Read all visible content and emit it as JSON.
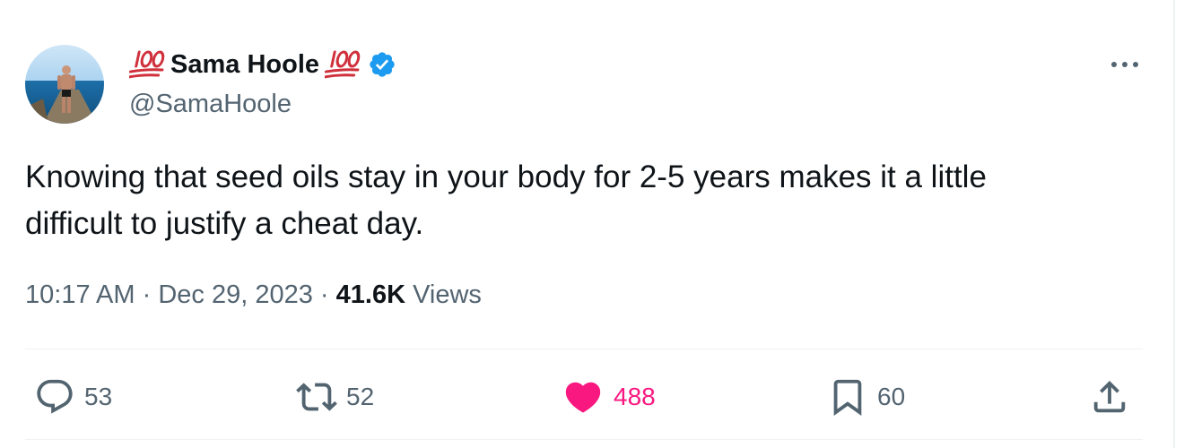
{
  "tweet": {
    "author": {
      "name_prefix_emoji": "💯",
      "display_name": "Sama Hoole",
      "name_suffix_emoji": "💯",
      "handle": "@SamaHoole",
      "verified": true
    },
    "text_line1": "Knowing that seed oils stay in your body for 2-5 years makes it a little",
    "text_line2": "difficult to justify a cheat day.",
    "time": "10:17 AM",
    "separator": "·",
    "date": "Dec 29, 2023",
    "views_count": "41.6K",
    "views_label": "Views",
    "actions": {
      "replies": "53",
      "reposts": "52",
      "likes": "488",
      "bookmarks": "60"
    }
  },
  "colors": {
    "text_primary": "#0f1419",
    "text_secondary": "#536471",
    "verified_blue": "#1d9bf0",
    "like_pink": "#f91880",
    "divider": "#eff3f4",
    "hundred_red": "#d0303b"
  },
  "icons": {
    "more": "more-horizontal-icon",
    "reply": "reply-bubble-icon",
    "repost": "repost-arrows-icon",
    "like": "heart-filled-icon",
    "bookmark": "bookmark-icon",
    "share": "share-upload-icon",
    "verified": "verified-badge-icon",
    "hundred": "hundred-points-emoji-icon"
  }
}
